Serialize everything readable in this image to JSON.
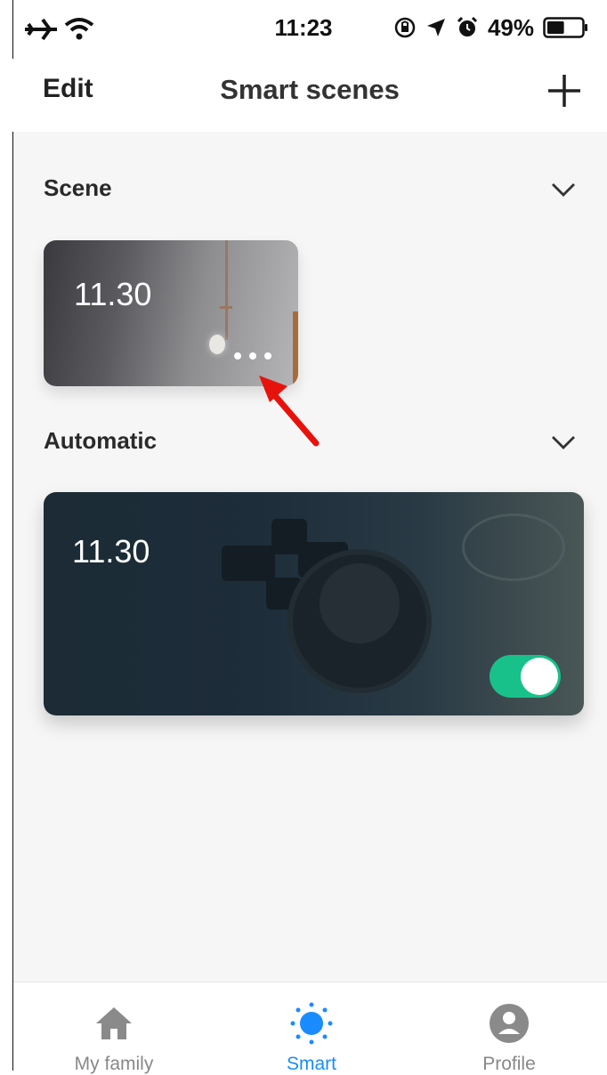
{
  "status_bar": {
    "time": "11:23",
    "battery_percent": "49%",
    "battery_level": 0.49,
    "icons": [
      "airplane-icon",
      "wifi-icon",
      "orientation-lock-icon",
      "location-icon",
      "alarm-icon",
      "battery-icon"
    ]
  },
  "header": {
    "edit_label": "Edit",
    "title": "Smart scenes",
    "add_icon": "plus-icon"
  },
  "sections": {
    "scene": {
      "title": "Scene",
      "cards": [
        {
          "name": "11.30",
          "more_icon": "more-dots-icon"
        }
      ]
    },
    "automatic": {
      "title": "Automatic",
      "cards": [
        {
          "name": "11.30",
          "enabled": true
        }
      ]
    }
  },
  "tab_bar": {
    "tabs": [
      {
        "label": "My family",
        "icon": "home-icon",
        "active": false
      },
      {
        "label": "Smart",
        "icon": "sun-icon",
        "active": true
      },
      {
        "label": "Profile",
        "icon": "profile-icon",
        "active": false
      }
    ]
  },
  "colors": {
    "accent": "#1a8cff",
    "toggle_on": "#19c18a",
    "annotation_arrow": "#e8120c",
    "content_bg": "#f6f6f6"
  }
}
